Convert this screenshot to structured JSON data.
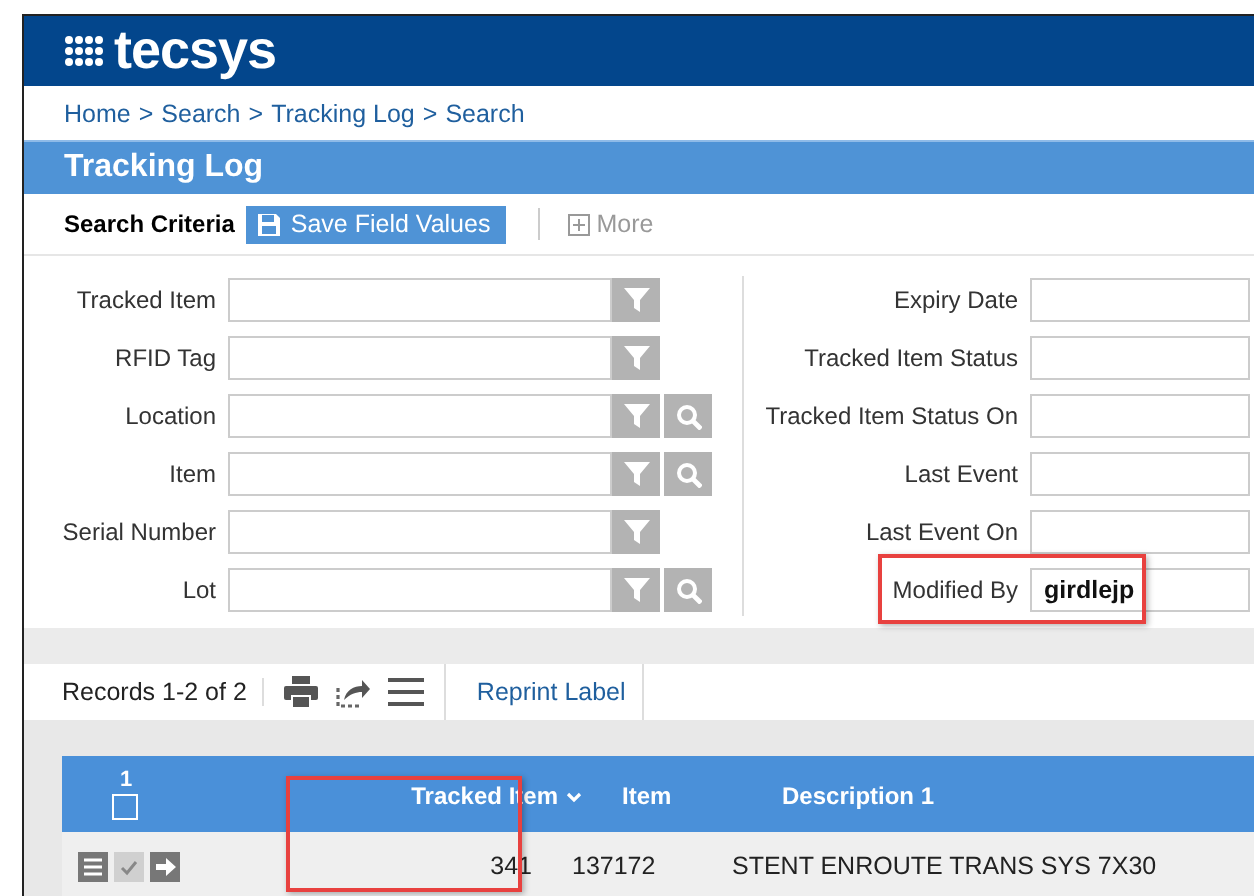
{
  "logo": {
    "text": "tecsys"
  },
  "breadcrumb": {
    "items": [
      "Home",
      "Search",
      "Tracking Log",
      "Search"
    ],
    "separator": ">"
  },
  "title": "Tracking Log",
  "search_criteria": {
    "label": "Search Criteria",
    "save_button": "Save Field Values",
    "more": "More"
  },
  "left_fields": [
    {
      "label": "Tracked Item",
      "lookup": false
    },
    {
      "label": "RFID Tag",
      "lookup": false
    },
    {
      "label": "Location",
      "lookup": true
    },
    {
      "label": "Item",
      "lookup": true
    },
    {
      "label": "Serial Number",
      "lookup": false
    },
    {
      "label": "Lot",
      "lookup": true
    }
  ],
  "right_fields": [
    {
      "label": "Expiry Date",
      "highlighted": false
    },
    {
      "label": "Tracked Item Status",
      "highlighted": false
    },
    {
      "label": "Tracked Item Status On",
      "highlighted": false
    },
    {
      "label": "Last Event",
      "highlighted": false
    },
    {
      "label": "Last Event On",
      "highlighted": false
    },
    {
      "label": "Modified By",
      "value": "girdlejp",
      "highlighted": true
    }
  ],
  "records": {
    "count": "Records 1-2 of 2",
    "action": "Reprint Label"
  },
  "grid": {
    "selection_count": "1",
    "select_all_checked": false,
    "columns": [
      {
        "label": "Tracked Item",
        "sorted": true,
        "highlighted": true
      },
      {
        "label": "Item",
        "sorted": false,
        "highlighted": false
      },
      {
        "label": "Description 1",
        "sorted": false,
        "highlighted": false
      }
    ],
    "rows": [
      {
        "cells": [
          "341",
          "137172",
          "STENT ENROUTE TRANS SYS 7X30"
        ]
      }
    ]
  }
}
